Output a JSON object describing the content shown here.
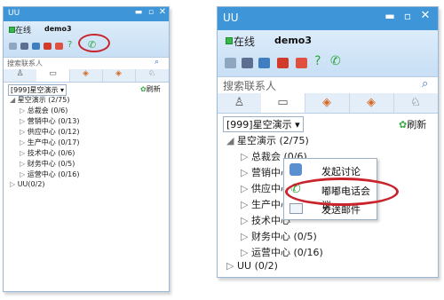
{
  "small": {
    "app_title": "UU",
    "status": "在线",
    "username": "demo3",
    "search_placeholder": "搜索联系人",
    "group_select": "[999]星空演示 ▾",
    "refresh": "刷新",
    "root": "星空演示 (2/75)",
    "items": [
      "总裁会 (0/6)",
      "营销中心 (0/13)",
      "供应中心 (0/12)",
      "生产中心 (0/17)",
      "技术中心 (0/6)",
      "财务中心 (0/5)",
      "运营中心 (0/16)"
    ],
    "uu_group": "UU(0/2)"
  },
  "large": {
    "app_title": "UU",
    "status": "在线",
    "username": "demo3",
    "search_placeholder": "搜索联系人",
    "group_select": "[999]星空演示 ▾",
    "refresh": "刷新",
    "root": "星空演示 (2/75)",
    "items": [
      "总裁会 (0/6)",
      "营销中心",
      "供应中心",
      "生产中心",
      "技术中心",
      "财务中心 (0/5)",
      "运营中心 (0/16)"
    ],
    "uu_group": "UU (0/2)"
  },
  "context_menu": [
    "发起讨论",
    "嘟嘟电话会议",
    "发送邮件"
  ],
  "colors": {
    "title_bar": "#3e96d8",
    "header": "#d4e7f8",
    "highlight": "#c9242c"
  }
}
